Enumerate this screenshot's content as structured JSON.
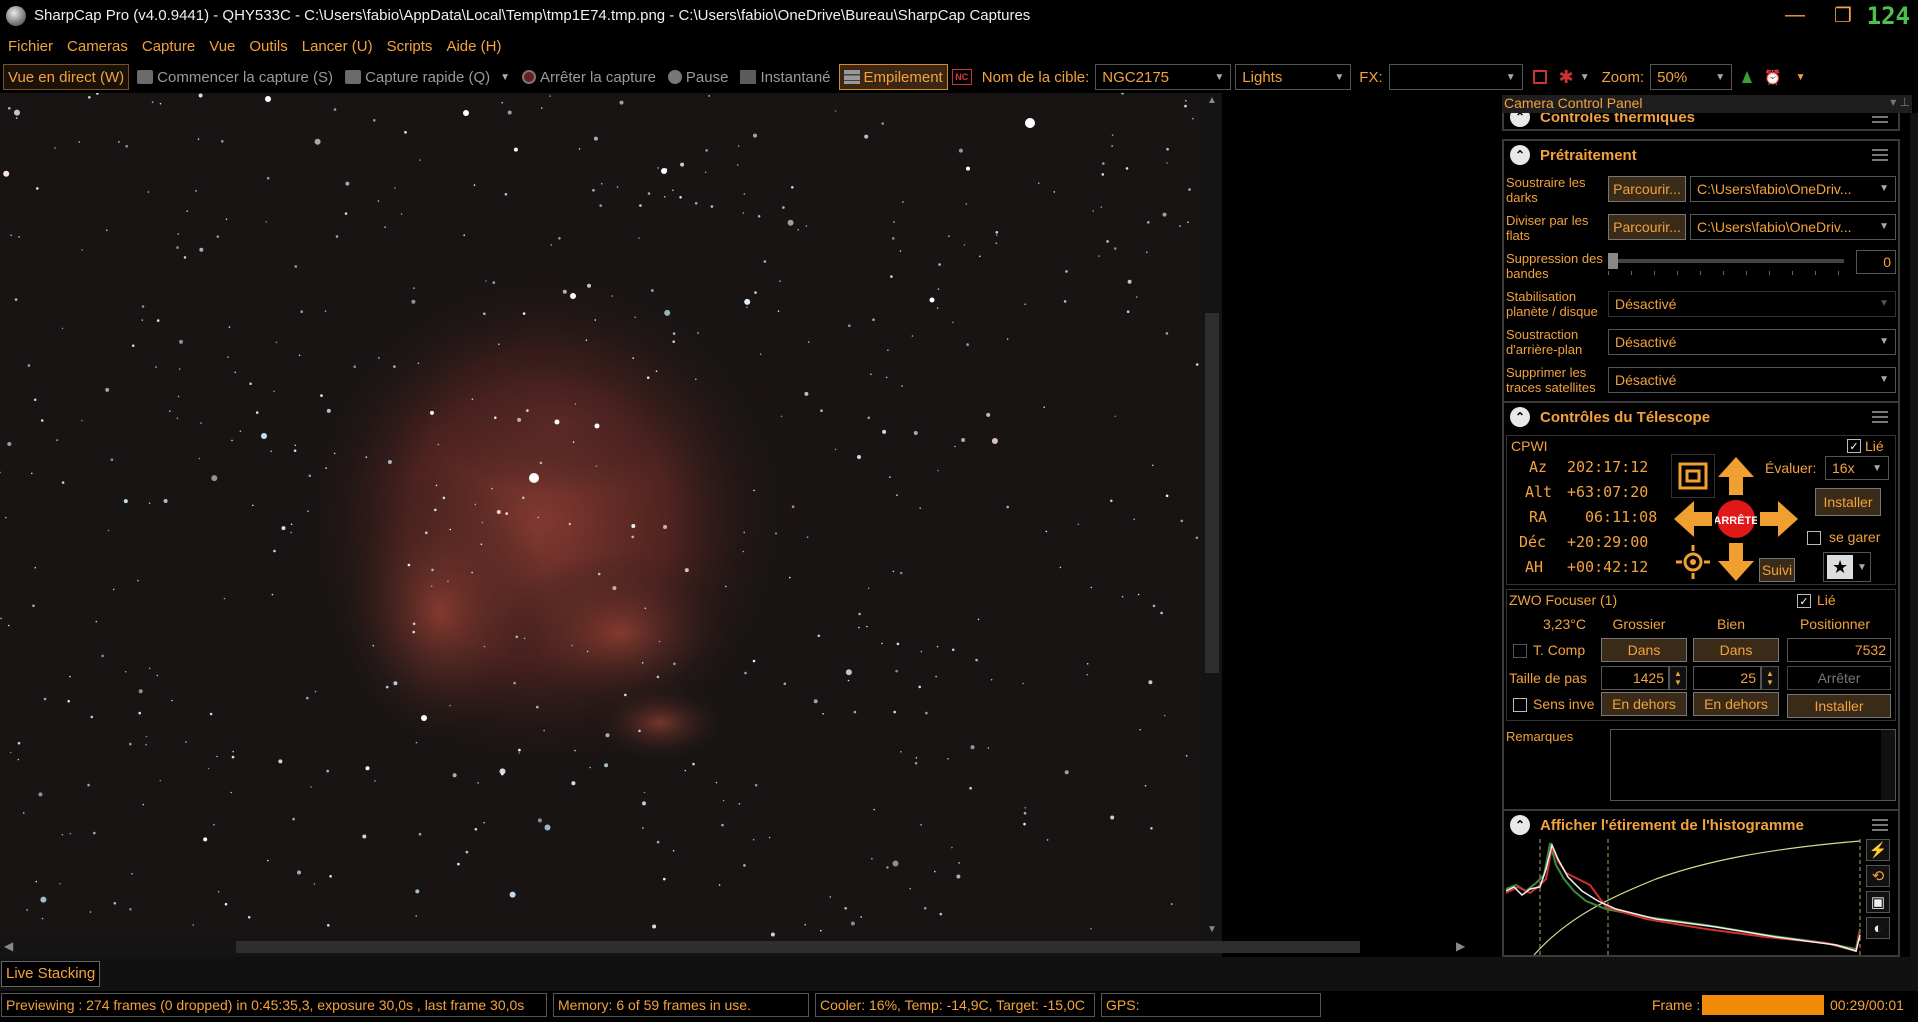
{
  "window": {
    "title": "SharpCap Pro (v4.0.9441) - QHY533C - C:\\Users\\fabio\\AppData\\Local\\Temp\\tmp1E74.tmp.png - C:\\Users\\fabio\\OneDrive\\Bureau\\SharpCap Captures",
    "fps": "124",
    "minimize": "—",
    "restore": "❐",
    "close": "✕"
  },
  "menu": [
    "Fichier",
    "Cameras",
    "Capture",
    "Vue",
    "Outils",
    "Lancer (U)",
    "Scripts",
    "Aide (H)"
  ],
  "toolbar": {
    "live_view": "Vue en direct (W)",
    "start_capture": "Commencer la capture (S)",
    "quick_capture": "Capture rapide (Q)",
    "stop_capture": "Arrêter la capture",
    "pause": "Pause",
    "snapshot": "Instantané",
    "stacking": "Empilement",
    "nc_badge": "NC",
    "target_label": "Nom de la cible:",
    "target_value": "NGC2175",
    "frame_type": "Lights",
    "fx_label": "FX:",
    "fx_value": "",
    "zoom_label": "Zoom:",
    "zoom_value": "50%"
  },
  "panel": {
    "title": "Camera Control Panel",
    "thermal": {
      "title": "Contrôles thermiques"
    },
    "preprocessing": {
      "title": "Prétraitement",
      "subtract_darks_label": "Soustraire les darks",
      "subtract_darks_button": "Parcourir...",
      "subtract_darks_path": "C:\\Users\\fabio\\OneDriv...",
      "divide_flats_label": "Diviser par les flats",
      "divide_flats_button": "Parcourir...",
      "divide_flats_path": "C:\\Users\\fabio\\OneDriv...",
      "banding_label": "Suppression des bandes",
      "banding_value": "0",
      "stabilization_label": "Stabilisation planète / disque",
      "stabilization_value": "Désactivé",
      "background_label": "Soustraction d'arrière-plan",
      "background_value": "Désactivé",
      "satellite_label": "Supprimer les traces satellites",
      "satellite_value": "Désactivé"
    },
    "telescope": {
      "title": "Contrôles du Télescope",
      "mount": "CPWI",
      "linked_label": "Lié",
      "linked": true,
      "coords": [
        {
          "label": "Az",
          "value": "202:17:12"
        },
        {
          "label": "Alt",
          "value": "+63:07:20"
        },
        {
          "label": "RA",
          "value": "06:11:08"
        },
        {
          "label": "Déc",
          "value": "+20:29:00"
        },
        {
          "label": "AH",
          "value": "+00:42:12"
        }
      ],
      "stop_label": "ARRÊTE",
      "rate_label": "Évaluer:",
      "rate_value": "16x",
      "install_button": "Installer",
      "park_label": "se garer",
      "track_button": "Suivi"
    },
    "focuser": {
      "title": "ZWO Focuser (1)",
      "linked_label": "Lié",
      "temperature": "3,23°C",
      "col_coarse": "Grossier",
      "col_fine": "Bien",
      "col_position": "Positionner",
      "temp_comp_label": "T. Comp",
      "in_coarse": "Dans",
      "in_fine": "Dans",
      "position_value": "7532",
      "step_size_label": "Taille de pas",
      "step_coarse": "1425",
      "step_fine": "25",
      "stop_button": "Arrêter",
      "reverse_label": "Sens inve",
      "out_coarse": "En dehors",
      "out_fine": "En dehors",
      "install_button": "Installer"
    },
    "notes": {
      "label": "Remarques",
      "value": ""
    },
    "histogram": {
      "title": "Afficher l'étirement de l'histogramme"
    }
  },
  "status": {
    "stack_tab": "Live Stacking",
    "preview": "Previewing : 274 frames (0 dropped) in 0:45:35,3, exposure 30,0s , last frame 30,0s",
    "memory": "Memory: 6 of 59 frames in use.",
    "cooler": "Cooler: 16%, Temp: -14,9C, Target: -15,0C",
    "gps": "GPS:",
    "frame_label": "Frame :",
    "frame_progress": 1.0,
    "frame_time": "00:29/00:01"
  },
  "colors": {
    "accent": "#f3a23c",
    "background": "#000000",
    "progress": "#f28a0a",
    "fps": "#4ec04e",
    "nebula": "#8a3a30"
  }
}
